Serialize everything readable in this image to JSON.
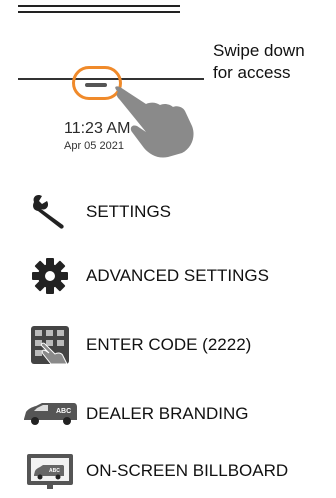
{
  "hint": {
    "line1": "Swipe down",
    "line2": "for access"
  },
  "clock": {
    "time": "11:23 AM",
    "date": "Apr 05 2021"
  },
  "menu": [
    {
      "label": "SETTINGS",
      "icon": "wrench-icon"
    },
    {
      "label": "ADVANCED SETTINGS",
      "icon": "gear-icon"
    },
    {
      "label": "ENTER CODE (2222)",
      "icon": "keypad-hand-icon"
    },
    {
      "label": "DEALER BRANDING",
      "icon": "van-icon"
    },
    {
      "label": "ON-SCREEN BILLBOARD",
      "icon": "billboard-van-icon"
    }
  ],
  "colors": {
    "accent": "#f08a2a",
    "icon": "#222222",
    "hand": "#8a8a8a"
  }
}
